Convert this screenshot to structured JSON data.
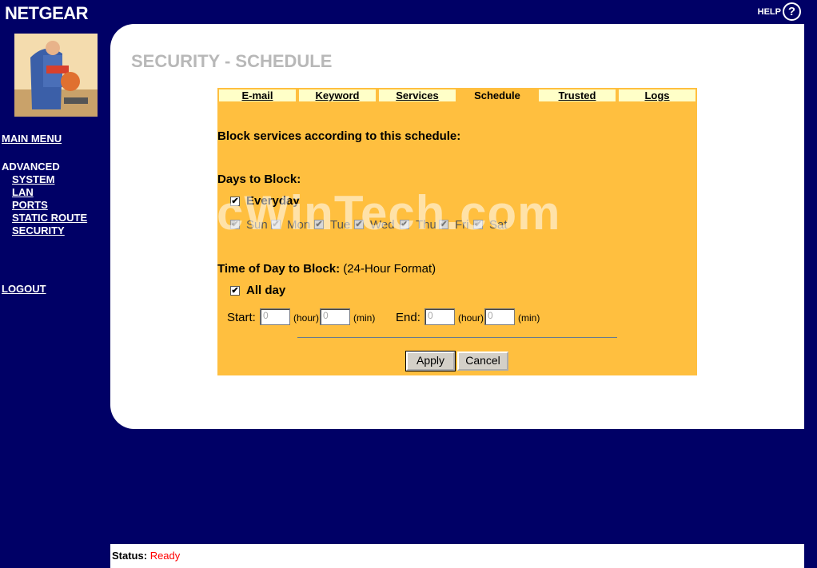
{
  "brand": "NETGEAR",
  "help": {
    "label": "HELP",
    "icon": "?"
  },
  "sidebar": {
    "main_menu": "MAIN MENU",
    "advanced": "ADVANCED",
    "items": [
      "SYSTEM",
      "LAN",
      "PORTS",
      "STATIC ROUTE",
      "SECURITY"
    ],
    "logout": "LOGOUT"
  },
  "page_title": "SECURITY - SCHEDULE",
  "tabs": [
    "E-mail",
    "Keyword",
    "Services",
    "Schedule",
    "Trusted",
    "Logs"
  ],
  "active_tab": "Schedule",
  "form": {
    "heading": "Block services according to this schedule:",
    "days_label": "Days to Block:",
    "everyday_label": "Everyday",
    "everyday_checked": true,
    "days": [
      "Sun",
      "Mon",
      "Tue",
      "Wed",
      "Thu",
      "Fri",
      "Sat"
    ],
    "time_label": "Time of Day to Block:",
    "time_format": "(24-Hour Format)",
    "allday_label": "All day",
    "allday_checked": true,
    "start_label": "Start:",
    "end_label": "End:",
    "hour_label": "(hour)",
    "min_label": "(min)",
    "start_hour": "0",
    "start_min": "0",
    "end_hour": "0",
    "end_min": "0",
    "apply": "Apply",
    "cancel": "Cancel"
  },
  "status": {
    "label": "Status:",
    "value": "Ready",
    "value_color": "#ff0000"
  },
  "watermark": "PcWinTech.com"
}
